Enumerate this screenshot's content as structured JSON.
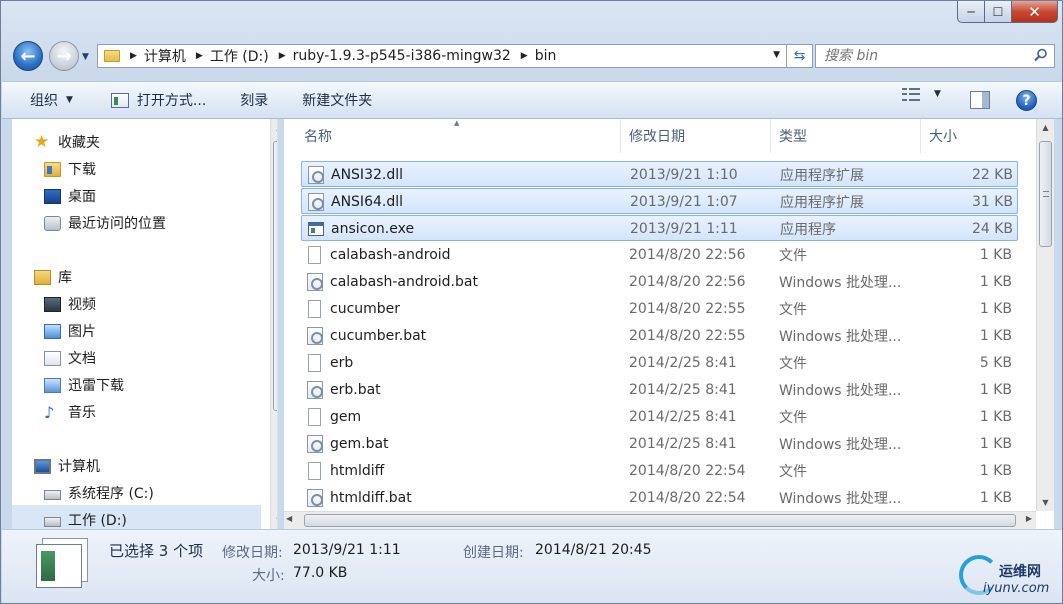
{
  "window": {
    "minimize_label": "─",
    "maximize_label": "☐",
    "close_label": "✕"
  },
  "address": {
    "breadcrumb": [
      "计算机",
      "工作 (D:)",
      "ruby-1.9.3-p545-i386-mingw32",
      "bin"
    ]
  },
  "search": {
    "placeholder": "搜索 bin"
  },
  "toolbar": {
    "organize": "组织",
    "open_with": "打开方式...",
    "burn": "刻录",
    "new_folder": "新建文件夹",
    "help": "?"
  },
  "nav": {
    "favorites": "收藏夹",
    "downloads": "下载",
    "desktop": "桌面",
    "recent": "最近访问的位置",
    "libraries": "库",
    "videos": "视频",
    "pictures": "图片",
    "documents": "文档",
    "thunder": "迅雷下载",
    "music": "音乐",
    "computer": "计算机",
    "drive_c": "系统程序 (C:)",
    "drive_d": "工作 (D:)"
  },
  "columns": {
    "name": "名称",
    "date": "修改日期",
    "type": "类型",
    "size": "大小"
  },
  "files": [
    {
      "name": "ANSI32.dll",
      "date": "2013/9/21 1:10",
      "type": "应用程序扩展",
      "size": "22 KB",
      "kind": "dll",
      "selected": true
    },
    {
      "name": "ANSI64.dll",
      "date": "2013/9/21 1:07",
      "type": "应用程序扩展",
      "size": "31 KB",
      "kind": "dll",
      "selected": true
    },
    {
      "name": "ansicon.exe",
      "date": "2013/9/21 1:11",
      "type": "应用程序",
      "size": "24 KB",
      "kind": "exe",
      "selected": true
    },
    {
      "name": "calabash-android",
      "date": "2014/8/20 22:56",
      "type": "文件",
      "size": "1 KB",
      "kind": "file",
      "selected": false
    },
    {
      "name": "calabash-android.bat",
      "date": "2014/8/20 22:56",
      "type": "Windows 批处理...",
      "size": "1 KB",
      "kind": "bat",
      "selected": false
    },
    {
      "name": "cucumber",
      "date": "2014/8/20 22:55",
      "type": "文件",
      "size": "1 KB",
      "kind": "file",
      "selected": false
    },
    {
      "name": "cucumber.bat",
      "date": "2014/8/20 22:55",
      "type": "Windows 批处理...",
      "size": "1 KB",
      "kind": "bat",
      "selected": false
    },
    {
      "name": "erb",
      "date": "2014/2/25 8:41",
      "type": "文件",
      "size": "5 KB",
      "kind": "file",
      "selected": false
    },
    {
      "name": "erb.bat",
      "date": "2014/2/25 8:41",
      "type": "Windows 批处理...",
      "size": "1 KB",
      "kind": "bat",
      "selected": false
    },
    {
      "name": "gem",
      "date": "2014/2/25 8:41",
      "type": "文件",
      "size": "1 KB",
      "kind": "file",
      "selected": false
    },
    {
      "name": "gem.bat",
      "date": "2014/2/25 8:41",
      "type": "Windows 批处理...",
      "size": "1 KB",
      "kind": "bat",
      "selected": false
    },
    {
      "name": "htmldiff",
      "date": "2014/8/20 22:54",
      "type": "文件",
      "size": "1 KB",
      "kind": "file",
      "selected": false
    },
    {
      "name": "htmldiff.bat",
      "date": "2014/8/20 22:54",
      "type": "Windows 批处理...",
      "size": "1 KB",
      "kind": "bat",
      "selected": false
    }
  ],
  "details": {
    "count": "已选择 3 个项",
    "modified_label": "修改日期:",
    "modified_value": "2013/9/21 1:11",
    "created_label": "创建日期:",
    "created_value": "2014/8/21 20:45",
    "size_label": "大小:",
    "size_value": "77.0 KB"
  },
  "watermark": {
    "cn": "运维网",
    "en": "iyunv.com"
  }
}
